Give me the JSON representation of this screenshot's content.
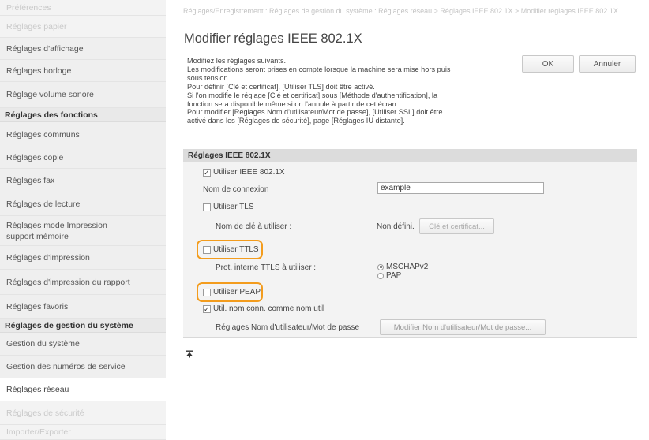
{
  "sidebar": {
    "items": [
      {
        "label": "Préférences",
        "kind": "faded"
      },
      {
        "label": "Réglages papier",
        "kind": "faded"
      },
      {
        "label": "Réglages d'affichage",
        "kind": "item"
      },
      {
        "label": "Réglages horloge",
        "kind": "item"
      },
      {
        "label": "Réglage volume sonore",
        "kind": "item"
      },
      {
        "label": "Réglages des fonctions",
        "kind": "section"
      },
      {
        "label": "Réglages communs",
        "kind": "item"
      },
      {
        "label": "Réglages copie",
        "kind": "item"
      },
      {
        "label": "Réglages fax",
        "kind": "item"
      },
      {
        "label": "Réglages de lecture",
        "kind": "item"
      },
      {
        "label": "Réglages mode Impression support mémoire",
        "kind": "item"
      },
      {
        "label": "Réglages d'impression",
        "kind": "item"
      },
      {
        "label": "Réglages d'impression du rapport",
        "kind": "item"
      },
      {
        "label": "Réglages favoris",
        "kind": "item"
      },
      {
        "label": "Réglages de gestion du système",
        "kind": "section"
      },
      {
        "label": "Gestion du système",
        "kind": "item"
      },
      {
        "label": "Gestion des numéros de service",
        "kind": "item"
      },
      {
        "label": "Réglages réseau",
        "kind": "selected"
      },
      {
        "label": "Réglages de sécurité",
        "kind": "faded"
      },
      {
        "label": "Importer/Exporter",
        "kind": "faded"
      }
    ]
  },
  "breadcrumb": "Réglages/Enregistrement : Réglages de gestion du système : Réglages réseau > Réglages IEEE 802.1X > Modifier réglages IEEE 802.1X",
  "page_title": "Modifier réglages IEEE 802.1X",
  "description": [
    "Modifiez les réglages suivants.",
    "Les modifications seront prises en compte lorsque la machine sera mise hors puis",
    "sous tension.",
    "Pour définir [Clé et certificat], [Utiliser TLS] doit être activé.",
    "Si l'on modifie le réglage [Clé et certificat] sous [Méthode d'authentification], la",
    "fonction sera disponible même si on l'annule à partir de cet écran.",
    "Pour modifier [Réglages Nom d'utilisateur/Mot de passe], [Utiliser SSL] doit être",
    "activé dans les [Réglages de sécurité], page [Réglages IU distante]."
  ],
  "buttons": {
    "ok": "OK",
    "cancel": "Annuler"
  },
  "section": {
    "title": "Réglages IEEE 802.1X",
    "use_ieee": "Utiliser IEEE 802.1X",
    "login_name_label": "Nom de connexion :",
    "login_name_value": "example",
    "use_tls": "Utiliser TLS",
    "key_name_label": "Nom de clé à utiliser :",
    "key_name_value": "Non défini.",
    "key_cert_button": "Clé et certificat...",
    "use_ttls": "Utiliser TTLS",
    "ttls_protocol_label": "Prot. interne TTLS à utiliser :",
    "ttls_options": [
      "MSCHAPv2",
      "PAP"
    ],
    "use_peap": "Utiliser PEAP",
    "same_name": "Util. nom conn. comme nom util",
    "user_pass_label": "Réglages Nom d'utilisateur/Mot de passe",
    "user_pass_button": "Modifier Nom d'utilisateur/Mot de passe..."
  },
  "states": {
    "use_ieee_checked": true,
    "use_tls_checked": false,
    "use_ttls_checked": false,
    "use_peap_checked": false,
    "same_name_checked": true,
    "ttls_selected": "MSCHAPv2"
  },
  "colors": {
    "highlight": "#f39c1d",
    "sidebar_bg": "#f2f2f2",
    "section_header_bg": "#dcdcdc"
  },
  "icons": {
    "back_to_top": "top-arrow-icon"
  }
}
